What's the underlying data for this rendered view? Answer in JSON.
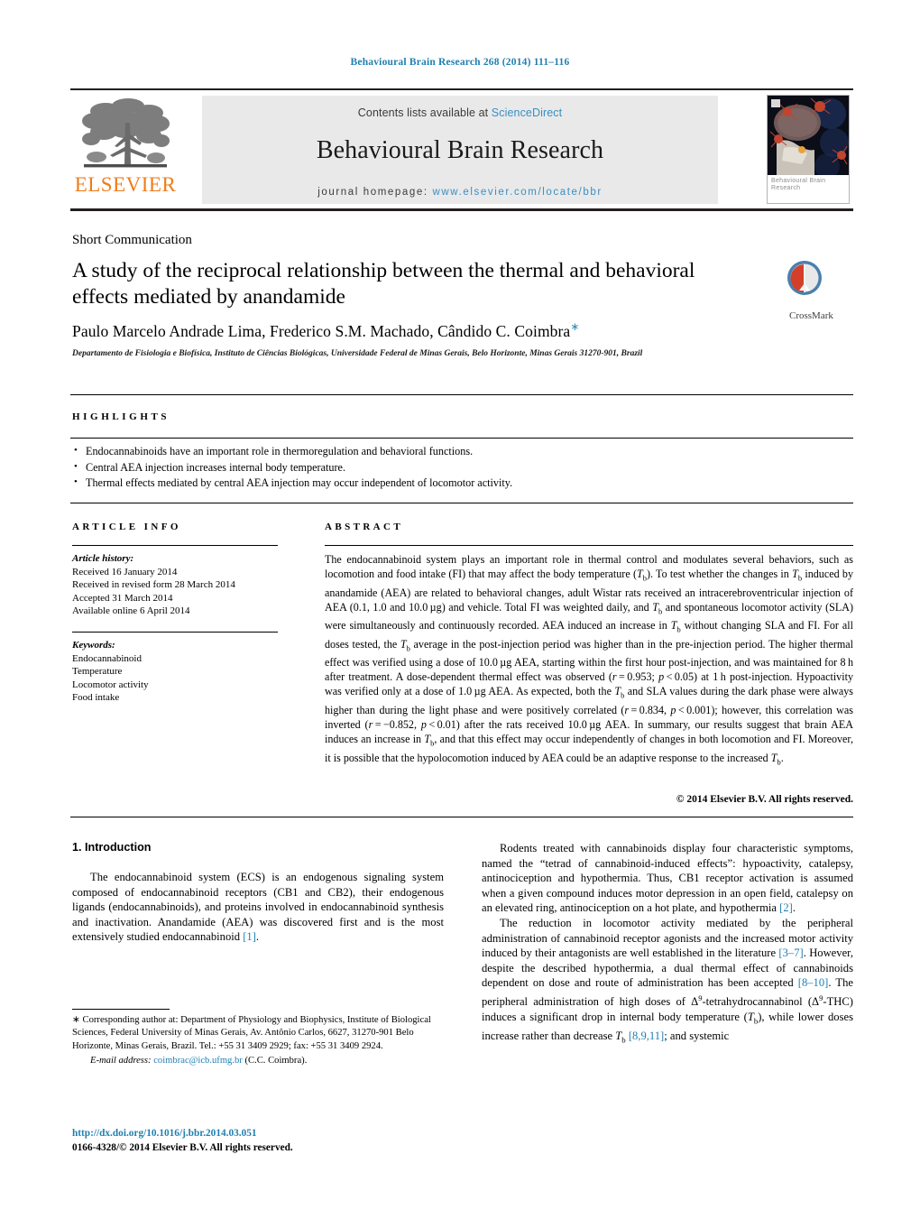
{
  "running_head": "Behavioural Brain Research 268 (2014) 111–116",
  "colors": {
    "link": "#1f7faf",
    "sciencedirect": "#3a8fc4",
    "elsevier_orange": "#ef7c1a",
    "band_gray": "#e9e9e9"
  },
  "masthead": {
    "publisher_logo_text": "ELSEVIER",
    "contents_prefix": "Contents lists available at ",
    "contents_link": "ScienceDirect",
    "journal_name": "Behavioural Brain Research",
    "homepage_prefix": "journal homepage: ",
    "homepage_url": "www.elsevier.com/locate/bbr",
    "cover_caption": "Behavioural Brain Research"
  },
  "article": {
    "type_label": "Short Communication",
    "title": "A study of the reciprocal relationship between the thermal and behavioral effects mediated by anandamide",
    "crossmark_label": "CrossMark",
    "authors": "Paulo Marcelo Andrade Lima, Frederico S.M. Machado, Cândido C. Coimbra",
    "corresponding_marker": "∗",
    "affiliation": "Departamento de Fisiologia e Biofísica, Instituto de Ciências Biológicas, Universidade Federal de Minas Gerais, Belo Horizonte, Minas Gerais 31270-901, Brazil"
  },
  "highlights": {
    "heading": "HIGHLIGHTS",
    "items": [
      "Endocannabinoids have an important role in thermoregulation and behavioral functions.",
      "Central AEA injection increases internal body temperature.",
      "Thermal effects mediated by central AEA injection may occur independent of locomotor activity."
    ]
  },
  "article_info": {
    "heading": "ARTICLE INFO",
    "history_label": "Article history:",
    "history": [
      "Received 16 January 2014",
      "Received in revised form 28 March 2014",
      "Accepted 31 March 2014",
      "Available online 6 April 2014"
    ],
    "keywords_label": "Keywords:",
    "keywords": [
      "Endocannabinoid",
      "Temperature",
      "Locomotor activity",
      "Food intake"
    ]
  },
  "abstract": {
    "heading": "ABSTRACT",
    "copyright": "© 2014 Elsevier B.V. All rights reserved."
  },
  "introduction": {
    "heading": "1. Introduction"
  },
  "footnote": {
    "corresponding": "∗ Corresponding author at: Department of Physiology and Biophysics, Institute of Biological Sciences, Federal University of Minas Gerais, Av. Antônio Carlos, 6627, 31270-901 Belo Horizonte, Minas Gerais, Brazil. Tel.: +55 31 3409 2929; fax: +55 31 3409 2924.",
    "email_label": "E-mail address:",
    "email": "coimbrac@icb.ufmg.br",
    "email_owner": "(C.C. Coimbra).",
    "doi": "http://dx.doi.org/10.1016/j.bbr.2014.03.051",
    "issn_line": "0166-4328/© 2014 Elsevier B.V. All rights reserved."
  }
}
